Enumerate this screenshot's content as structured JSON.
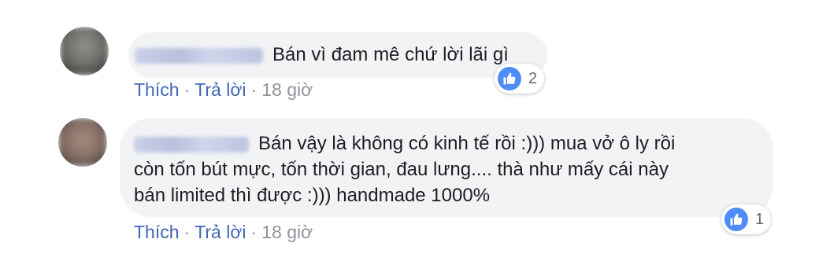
{
  "colors": {
    "bubble_bg": "#f2f3f5",
    "link": "#4267b2",
    "meta": "#90949c",
    "like": "#4e8cf7"
  },
  "comments": [
    {
      "text_lines": [
        "Bán vì đam mê chứ lời lãi gì"
      ],
      "actions": {
        "like": "Thích",
        "reply": "Trả lời",
        "time": "18 giờ"
      },
      "reaction_count": "2",
      "reaction_icon": "like-icon"
    },
    {
      "text_lines": [
        "Bán vậy là không có kinh tế rồi :))) mua vở ô ly rồi",
        "còn tốn bút mực, tốn thời gian, đau lưng.... thà như mấy cái này",
        "bán limited thì được :))) handmade 1000%"
      ],
      "actions": {
        "like": "Thích",
        "reply": "Trả lời",
        "time": "18 giờ"
      },
      "reaction_count": "1",
      "reaction_icon": "like-icon"
    }
  ]
}
